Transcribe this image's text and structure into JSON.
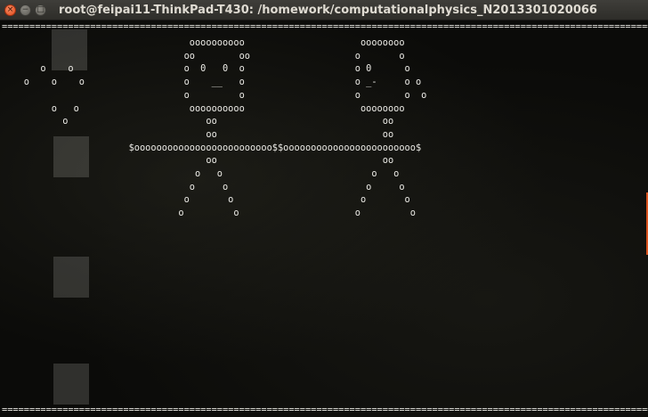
{
  "window": {
    "title": "root@feipai11-ThinkPad-T430: /homework/computationalphysics_N2013301020066",
    "close_glyph": "×",
    "minimize_glyph": "−",
    "maximize_glyph": "□"
  },
  "terminal": {
    "top_separator": "======================================================================================================================",
    "bottom_separator": "======================================================================================================================",
    "art": "                                  oooooooooo                     oooooooo\n                                 oo        oo                   o       o\n       o    o                    o  0   0  o                    o 0      o\n    o    o    o                  o    __   o                    o _-     o o\n                                 o         o                    o        o  o\n         o   o                    oooooooooo                     oooooooo\n           o                         oo                              oo\n                                     oo                              oo\n                       $ooooooooooooooooooooooooo$$oooooooooooooooooooooooo$\n                                     oo                              oo\n                                   o   o                           o   o\n                                  o     o                         o     o\n                                 o       o                       o       o\n                                o         o                     o         o"
  },
  "desktop_icons": [
    {
      "name": "folder",
      "label": ""
    },
    {
      "name": "document",
      "label": ""
    },
    {
      "name": "document",
      "label": ""
    },
    {
      "name": "document",
      "label": ""
    }
  ],
  "colors": {
    "terminal_bg": "#0b0b09",
    "text": "#ecebe6",
    "titlebar": "#3a3935",
    "close_button": "#e4572a"
  }
}
